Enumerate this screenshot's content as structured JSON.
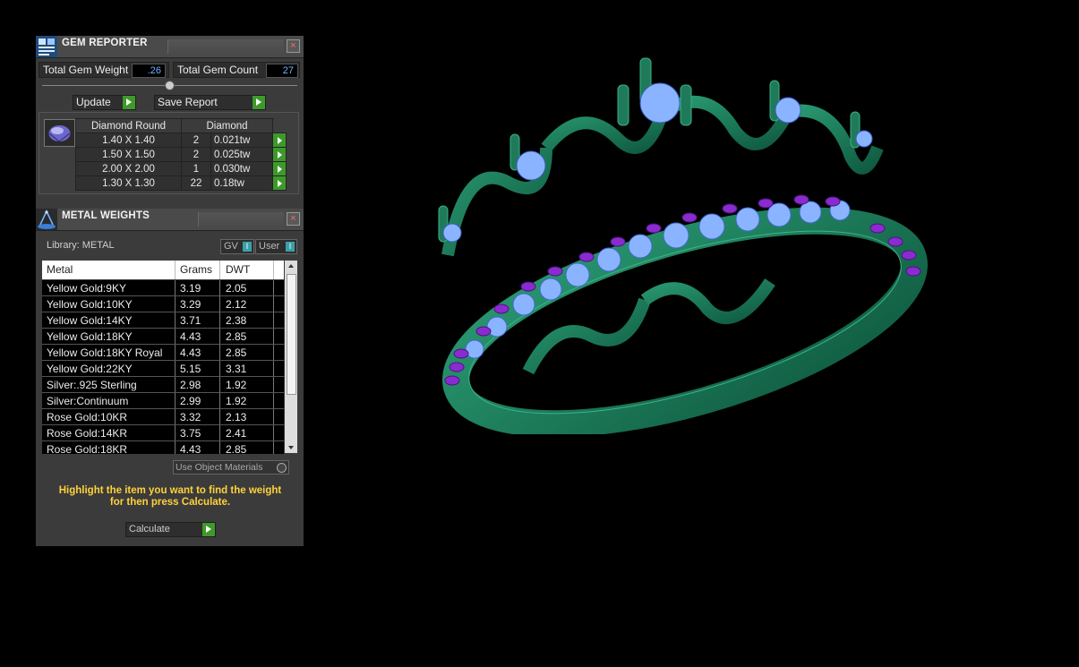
{
  "gem_reporter": {
    "title": "GEM REPORTER",
    "close_label": "×",
    "total_weight_label": "Total Gem Weight",
    "total_weight_value": ".26",
    "total_count_label": "Total Gem Count",
    "total_count_value": "27",
    "update_label": "Update",
    "save_report_label": "Save Report",
    "table": {
      "headers": [
        "Diamond Round",
        "Diamond"
      ],
      "rows": [
        {
          "size": "1.40 X 1.40",
          "count": "2",
          "weight": "0.021tw"
        },
        {
          "size": "1.50 X 1.50",
          "count": "2",
          "weight": "0.025tw"
        },
        {
          "size": "2.00 X 2.00",
          "count": "1",
          "weight": "0.030tw"
        },
        {
          "size": "1.30 X 1.30",
          "count": "22",
          "weight": "0.18tw"
        }
      ]
    }
  },
  "metal_weights": {
    "title": "METAL WEIGHTS",
    "close_label": "×",
    "library_label": "Library: METAL",
    "gv_label": "GV",
    "user_label": "User",
    "columns": [
      "Metal",
      "Grams",
      "DWT"
    ],
    "rows": [
      {
        "metal": "Yellow Gold:9KY",
        "grams": "3.19",
        "dwt": "2.05"
      },
      {
        "metal": "Yellow Gold:10KY",
        "grams": "3.29",
        "dwt": "2.12"
      },
      {
        "metal": "Yellow Gold:14KY",
        "grams": "3.71",
        "dwt": "2.38"
      },
      {
        "metal": "Yellow Gold:18KY",
        "grams": "4.43",
        "dwt": "2.85"
      },
      {
        "metal": "Yellow Gold:18KY Royal",
        "grams": "4.43",
        "dwt": "2.85"
      },
      {
        "metal": "Yellow Gold:22KY",
        "grams": "5.15",
        "dwt": "3.31"
      },
      {
        "metal": "Silver:.925 Sterling",
        "grams": "2.98",
        "dwt": "1.92"
      },
      {
        "metal": "Silver:Continuum",
        "grams": "2.99",
        "dwt": "1.92"
      },
      {
        "metal": "Rose Gold:10KR",
        "grams": "3.32",
        "dwt": "2.13"
      },
      {
        "metal": "Rose Gold:14KR",
        "grams": "3.75",
        "dwt": "2.41"
      },
      {
        "metal": "Rose Gold:18KR",
        "grams": "4.43",
        "dwt": "2.85"
      }
    ],
    "use_object_materials_label": "Use Object Materials",
    "hint_line1": "Highlight the item you want to find the weight",
    "hint_line2": "for then press Calculate.",
    "calculate_label": "Calculate"
  },
  "colors": {
    "ring_metal": "#1f7a5a",
    "gem_blue": "#8ab4ff",
    "gem_purple": "#8a2bd0",
    "accent_green": "#3d9a2a",
    "hint_yellow": "#ffd23a"
  }
}
